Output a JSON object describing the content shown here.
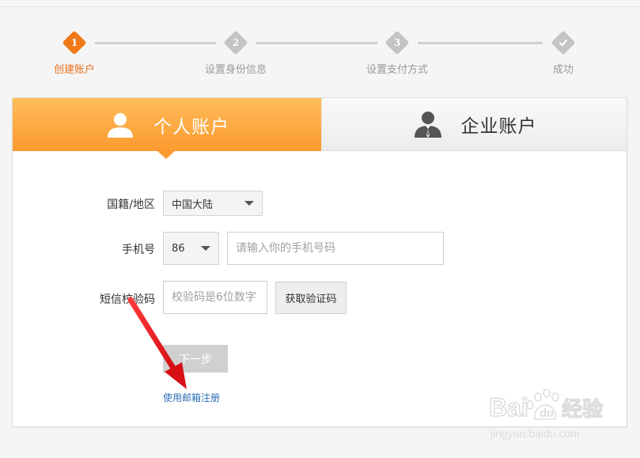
{
  "steps": [
    {
      "number": "1",
      "label": "创建账户",
      "state": "active"
    },
    {
      "number": "2",
      "label": "设置身份信息",
      "state": "inactive"
    },
    {
      "number": "3",
      "label": "设置支付方式",
      "state": "inactive"
    },
    {
      "number": "",
      "label": "成功",
      "state": "inactive"
    }
  ],
  "tabs": {
    "personal_label": "个人账户",
    "business_label": "企业账户"
  },
  "form": {
    "region_label": "国籍/地区",
    "region_value": "中国大陆",
    "phone_label": "手机号",
    "phone_code_value": "86",
    "phone_placeholder": "请输入你的手机号码",
    "sms_label": "短信校验码",
    "sms_placeholder": "校验码是6位数字",
    "get_code_label": "获取验证码",
    "next_label": "下一步",
    "email_link": "使用邮箱注册"
  },
  "watermark": {
    "logo": "Bai du 经验",
    "url": "jingyan.baidu.com"
  },
  "colors": {
    "accent": "#f07a1a",
    "tab_active": "#fb9a2f",
    "arrow": "#e8151b",
    "link": "#2a6db5"
  },
  "icons": {
    "personal": "user-icon",
    "business": "businessman-icon",
    "success": "check-icon"
  }
}
